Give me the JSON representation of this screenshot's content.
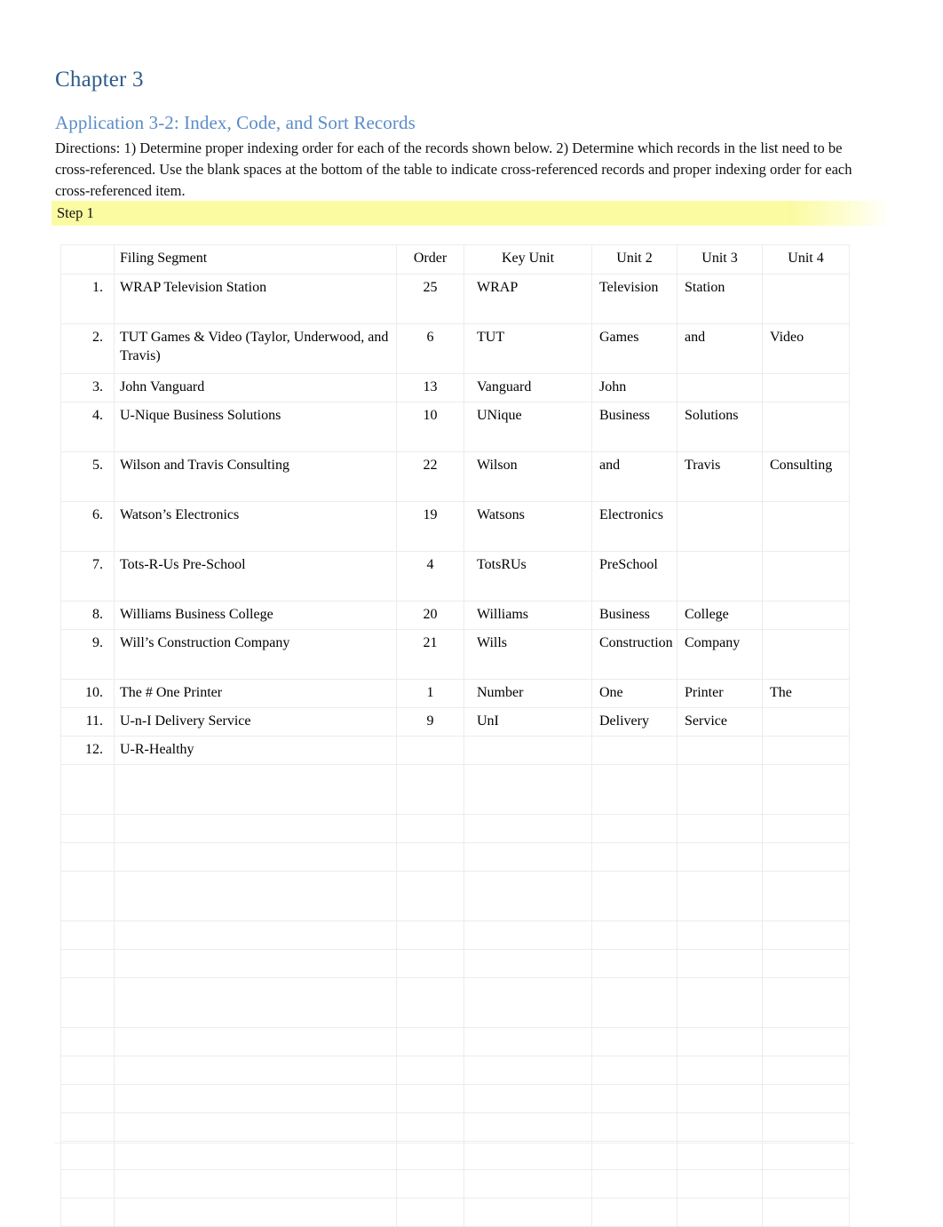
{
  "document": {
    "chapter_title": "Chapter 3",
    "application_title": "Application 3-2: Index, Code, and Sort Records",
    "directions": "Directions:  1) Determine proper indexing order for each of the records shown below. 2) Determine which records in the list need to be cross-referenced. Use the blank spaces at the bottom of the table to indicate cross-referenced records and proper indexing order for each cross-referenced item.",
    "step_label": "Step 1",
    "colors": {
      "chapter_heading": "#2e5c8a",
      "application_heading": "#5b8cc8",
      "highlight": "#fbfba2",
      "body_text": "#121212",
      "grid_line": "#ececec"
    }
  },
  "table": {
    "headers": {
      "num": "",
      "filing_segment": "Filing Segment",
      "order": "Order",
      "key_unit": "Key Unit",
      "unit2": "Unit 2",
      "unit3": "Unit 3",
      "unit4": "Unit 4"
    },
    "rows": [
      {
        "num": "1.",
        "filing_segment": "WRAP Television Station",
        "order": "25",
        "key_unit": "WRAP",
        "unit2": "Television",
        "unit3": "Station",
        "unit4": ""
      },
      {
        "num": "2.",
        "filing_segment": "TUT Games & Video (Taylor, Underwood, and Travis)",
        "order": "6",
        "key_unit": "TUT",
        "unit2": "Games",
        "unit3": "and",
        "unit4": "Video"
      },
      {
        "num": "3.",
        "filing_segment": "John Vanguard",
        "order": "13",
        "key_unit": "Vanguard",
        "unit2": "John",
        "unit3": "",
        "unit4": ""
      },
      {
        "num": "4.",
        "filing_segment": "U-Nique Business Solutions",
        "order": "10",
        "key_unit": "UNique",
        "unit2": "Business",
        "unit3": "Solutions",
        "unit4": ""
      },
      {
        "num": "5.",
        "filing_segment": "Wilson and Travis Consulting",
        "order": "22",
        "key_unit": "Wilson",
        "unit2": "and",
        "unit3": "Travis",
        "unit4": "Consulting"
      },
      {
        "num": "6.",
        "filing_segment": "Watson’s Electronics",
        "order": "19",
        "key_unit": "Watsons",
        "unit2": "Electronics",
        "unit3": "",
        "unit4": ""
      },
      {
        "num": "7.",
        "filing_segment": "Tots-R-Us Pre-School",
        "order": "4",
        "key_unit": "TotsRUs",
        "unit2": "PreSchool",
        "unit3": "",
        "unit4": ""
      },
      {
        "num": "8.",
        "filing_segment": "Williams Business College",
        "order": "20",
        "key_unit": "Williams",
        "unit2": "Business",
        "unit3": "College",
        "unit4": ""
      },
      {
        "num": "9.",
        "filing_segment": "Will’s Construction Company",
        "order": "21",
        "key_unit": "Wills",
        "unit2": "Construction",
        "unit3": "Company",
        "unit4": ""
      },
      {
        "num": "10.",
        "filing_segment": "The # One Printer",
        "order": "1",
        "key_unit": "Number",
        "unit2": "One",
        "unit3": "Printer",
        "unit4": "The"
      },
      {
        "num": "11.",
        "filing_segment": "U-n-I Delivery Service",
        "order": "9",
        "key_unit": "UnI",
        "unit2": "Delivery",
        "unit3": "Service",
        "unit4": ""
      },
      {
        "num": "12.",
        "filing_segment": "U-R-Healthy",
        "order": "",
        "key_unit": "",
        "unit2": "",
        "unit3": "",
        "unit4": ""
      },
      {
        "num": "",
        "filing_segment": "",
        "order": "",
        "key_unit": "",
        "unit2": "",
        "unit3": "",
        "unit4": ""
      },
      {
        "num": "",
        "filing_segment": "",
        "order": "",
        "key_unit": "",
        "unit2": "",
        "unit3": "",
        "unit4": ""
      },
      {
        "num": "",
        "filing_segment": "",
        "order": "",
        "key_unit": "",
        "unit2": "",
        "unit3": "",
        "unit4": ""
      },
      {
        "num": "",
        "filing_segment": "",
        "order": "",
        "key_unit": "",
        "unit2": "",
        "unit3": "",
        "unit4": ""
      },
      {
        "num": "",
        "filing_segment": "",
        "order": "",
        "key_unit": "",
        "unit2": "",
        "unit3": "",
        "unit4": ""
      },
      {
        "num": "",
        "filing_segment": "",
        "order": "",
        "key_unit": "",
        "unit2": "",
        "unit3": "",
        "unit4": ""
      },
      {
        "num": "",
        "filing_segment": "",
        "order": "",
        "key_unit": "",
        "unit2": "",
        "unit3": "",
        "unit4": ""
      },
      {
        "num": "",
        "filing_segment": "",
        "order": "",
        "key_unit": "",
        "unit2": "",
        "unit3": "",
        "unit4": ""
      },
      {
        "num": "",
        "filing_segment": "",
        "order": "",
        "key_unit": "",
        "unit2": "",
        "unit3": "",
        "unit4": ""
      },
      {
        "num": "",
        "filing_segment": "",
        "order": "",
        "key_unit": "",
        "unit2": "",
        "unit3": "",
        "unit4": ""
      },
      {
        "num": "",
        "filing_segment": "",
        "order": "",
        "key_unit": "",
        "unit2": "",
        "unit3": "",
        "unit4": ""
      },
      {
        "num": "",
        "filing_segment": "",
        "order": "",
        "key_unit": "",
        "unit2": "",
        "unit3": "",
        "unit4": ""
      },
      {
        "num": "",
        "filing_segment": "",
        "order": "",
        "key_unit": "",
        "unit2": "",
        "unit3": "",
        "unit4": ""
      },
      {
        "num": "",
        "filing_segment": "",
        "order": "",
        "key_unit": "",
        "unit2": "",
        "unit3": "",
        "unit4": ""
      }
    ]
  },
  "footer": {
    "left": "",
    "right": ""
  }
}
